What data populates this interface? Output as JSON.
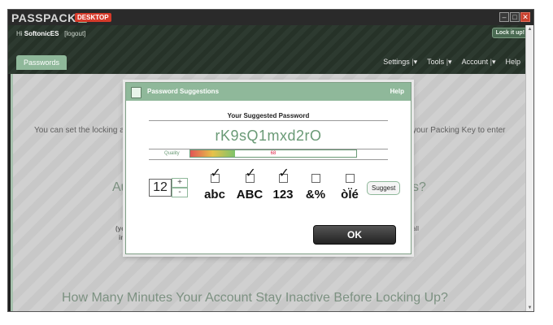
{
  "app": {
    "brand": "PASSPACK",
    "edition_badge": "DESKTOP",
    "window_controls": {
      "minimize": "–",
      "maximize": "□",
      "close": "✕"
    }
  },
  "header": {
    "greeting_prefix": "Hi",
    "username": "SoftonicES",
    "logout": "[logout]",
    "lock_button": "Lock it up!"
  },
  "tabs": [
    {
      "label": "Passwords"
    }
  ],
  "menu": {
    "items": [
      {
        "label": "Settings",
        "dropdown": "▾"
      },
      {
        "label": "Tools",
        "dropdown": "▾"
      },
      {
        "label": "Account",
        "dropdown": "▾"
      },
      {
        "label": "Help"
      }
    ]
  },
  "background": {
    "left_text": "You can set the locking ar",
    "right_text": "your Packing Key to enter",
    "heading_left": "Au",
    "heading_right": "s?",
    "fragment_left_1": "(you",
    "fragment_left_2": "im",
    "fragment_right": "all",
    "bottom_heading": "How Many Minutes Your Account Stay Inactive Before Locking Up?"
  },
  "dialog": {
    "title": "Password Suggestions",
    "help": "Help",
    "suggested_label": "Your Suggested Password",
    "password": "rK9sQ1mxd2rO",
    "quality_label": "Quality",
    "quality_value": "68",
    "quality_percent": 68,
    "length": "12",
    "plus": "+",
    "minus": "-",
    "options": [
      {
        "label": "abc",
        "checked": true
      },
      {
        "label": "ABC",
        "checked": true
      },
      {
        "label": "123",
        "checked": true
      },
      {
        "label": "&%",
        "checked": false
      },
      {
        "label": "òÏé",
        "checked": false
      }
    ],
    "suggest_button": "Suggest",
    "ok_button": "OK"
  },
  "colors": {
    "accent": "#8fb89a",
    "password_text": "#6a9a76",
    "close_button": "#c8402d"
  }
}
